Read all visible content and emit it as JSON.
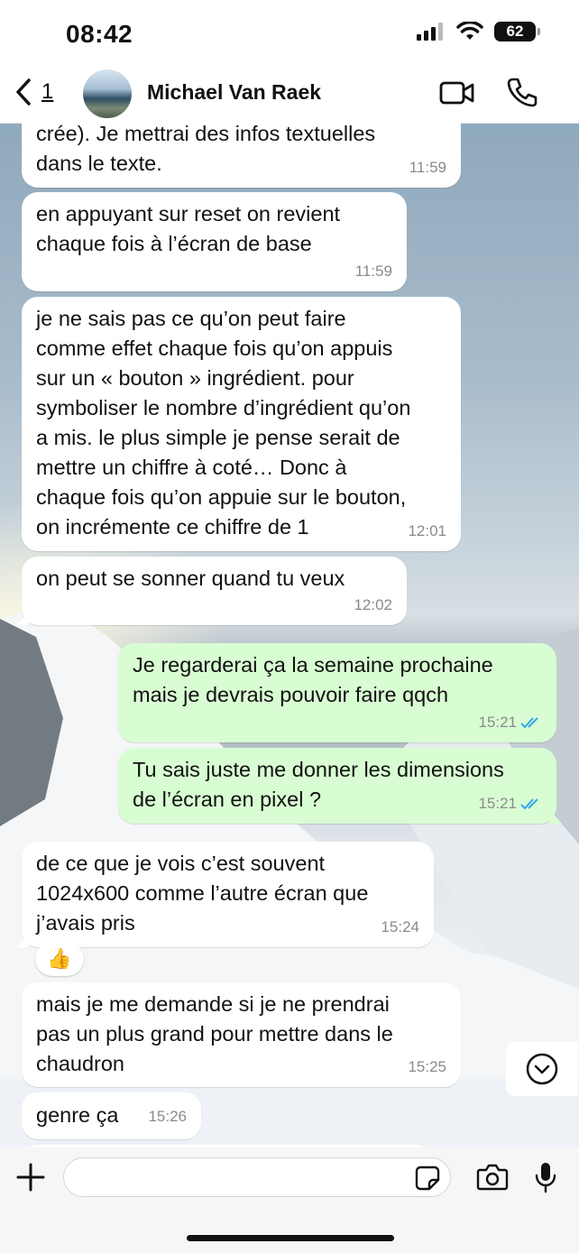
{
  "status": {
    "time": "08:42",
    "battery": "62"
  },
  "header": {
    "back_count": "1",
    "contact_name": "Michael Van Raek"
  },
  "messages": [
    {
      "dir": "in",
      "text": "crée). Je mettrai des infos textuelles\ndans le texte.",
      "time": "11:59"
    },
    {
      "dir": "in",
      "text": "en appuyant sur reset on revient\nchaque fois à l’écran de base",
      "time": "11:59"
    },
    {
      "dir": "in",
      "text": "je ne sais pas ce qu’on peut faire\ncomme effet chaque fois qu’on appuis\nsur un « bouton » ingrédient. pour\nsymboliser le nombre d’ingrédient qu’on\na mis. le plus simple je pense serait de\nmettre un chiffre à coté… Donc à\nchaque fois qu’on appuie sur le bouton,\non incrémente ce chiffre de 1",
      "time": "12:01"
    },
    {
      "dir": "in",
      "text": "on peut se sonner quand tu veux",
      "time": "12:02"
    },
    {
      "dir": "out",
      "text": "Je regarderai ça la semaine prochaine\nmais je devrais pouvoir faire qqch",
      "time": "15:21"
    },
    {
      "dir": "out",
      "text": "Tu sais juste me donner les dimensions\nde l’écran en pixel ?",
      "time": "15:21"
    },
    {
      "dir": "in",
      "text": "de ce que je vois c’est souvent\n1024x600 comme l’autre écran que\nj’avais pris",
      "time": "15:24"
    },
    {
      "dir": "in",
      "text": "mais je me demande si je ne prendrai\npas un plus grand pour mettre dans le\nchaudron",
      "time": "15:25"
    },
    {
      "dir": "in",
      "text": "genre ça",
      "time": "15:26"
    }
  ],
  "reaction": {
    "emoji": "👍"
  },
  "composer": {
    "placeholder": ""
  },
  "colors": {
    "incoming": "#ffffff",
    "outgoing": "#d9fdd3",
    "read_ticks": "#34a8eb"
  }
}
